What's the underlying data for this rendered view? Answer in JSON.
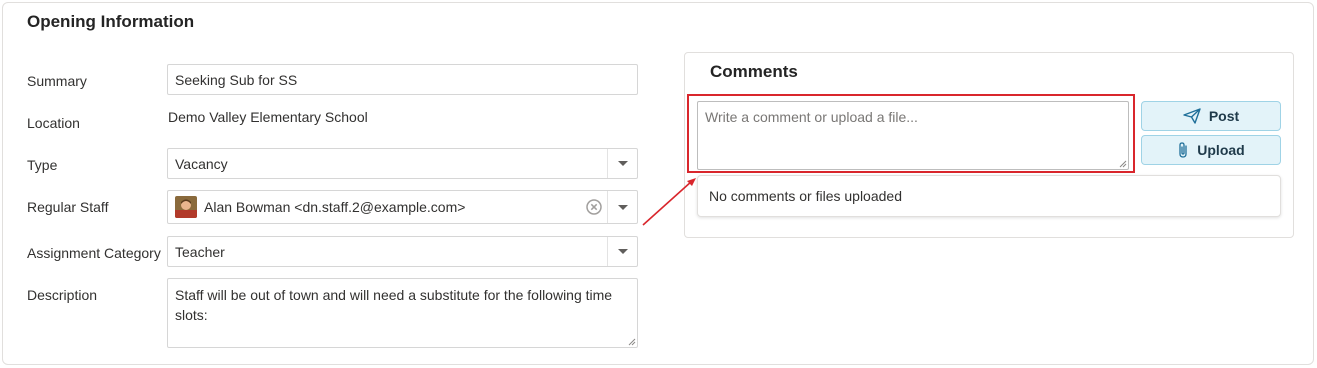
{
  "section": {
    "title": "Opening Information"
  },
  "form": {
    "summary": {
      "label": "Summary",
      "value": "Seeking Sub for SS"
    },
    "location": {
      "label": "Location",
      "value": "Demo Valley Elementary School"
    },
    "type": {
      "label": "Type",
      "value": "Vacancy"
    },
    "regular_staff": {
      "label": "Regular Staff",
      "value": "Alan Bowman <dn.staff.2@example.com>"
    },
    "assignment_category": {
      "label": "Assignment Category",
      "value": "Teacher"
    },
    "description": {
      "label": "Description",
      "value": "Staff will be out of town and will need a substitute for the following time slots:"
    }
  },
  "comments": {
    "title": "Comments",
    "input_placeholder": "Write a comment or upload a file...",
    "post_label": "Post",
    "upload_label": "Upload",
    "empty_text": "No comments or files uploaded"
  },
  "icons": {
    "post": "send-icon",
    "upload": "paperclip-icon",
    "clear": "clear-circle-icon",
    "dropdown": "chevron-down-icon"
  },
  "colors": {
    "highlight": "#d9262c",
    "button_bg": "#e3f3f9",
    "button_border": "#9fd3e6"
  }
}
